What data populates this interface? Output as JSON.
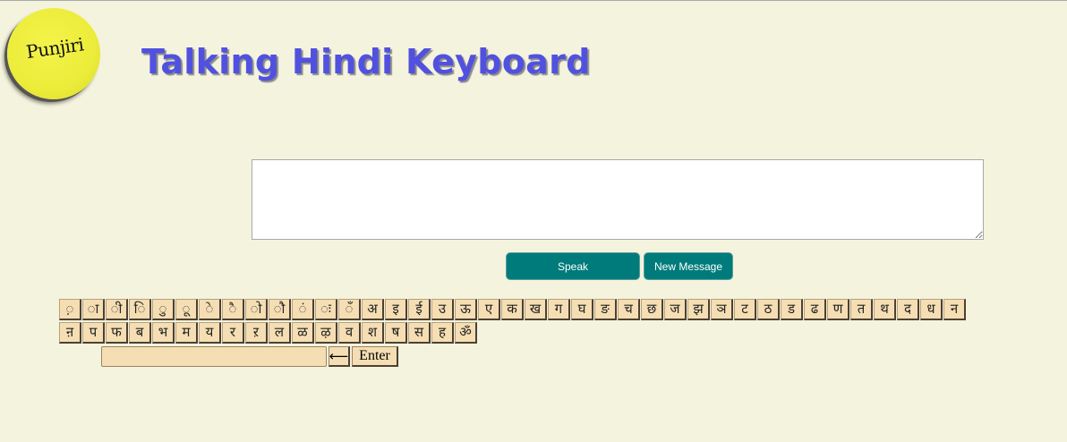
{
  "logo": {
    "text": "Punjiri"
  },
  "title": "Talking Hindi Keyboard",
  "message": {
    "value": ""
  },
  "buttons": {
    "speak": "Speak",
    "new_message": "New Message"
  },
  "keyboard": {
    "row1": [
      "़",
      "ा",
      "ी",
      "ि",
      "ु",
      "ू",
      "े",
      "ै",
      "ो",
      "ौ",
      "ं",
      "ः",
      "ँ",
      "अ",
      "इ",
      "ई",
      "उ",
      "ऊ",
      "ए",
      "क",
      "ख",
      "ग",
      "घ",
      "ङ",
      "च",
      "छ",
      "ज",
      "झ",
      "ञ",
      "ट",
      "ठ",
      "ड",
      "ढ",
      "ण",
      "त",
      "थ",
      "द",
      "ध",
      "न"
    ],
    "row2": [
      "ऩ",
      "प",
      "फ",
      "ब",
      "भ",
      "म",
      "य",
      "र",
      "ऱ",
      "ल",
      "ळ",
      "ऴ",
      "व",
      "श",
      "ष",
      "स",
      "ह",
      "ॐ"
    ],
    "input_value": "",
    "backspace": "⟵",
    "enter": "Enter"
  }
}
